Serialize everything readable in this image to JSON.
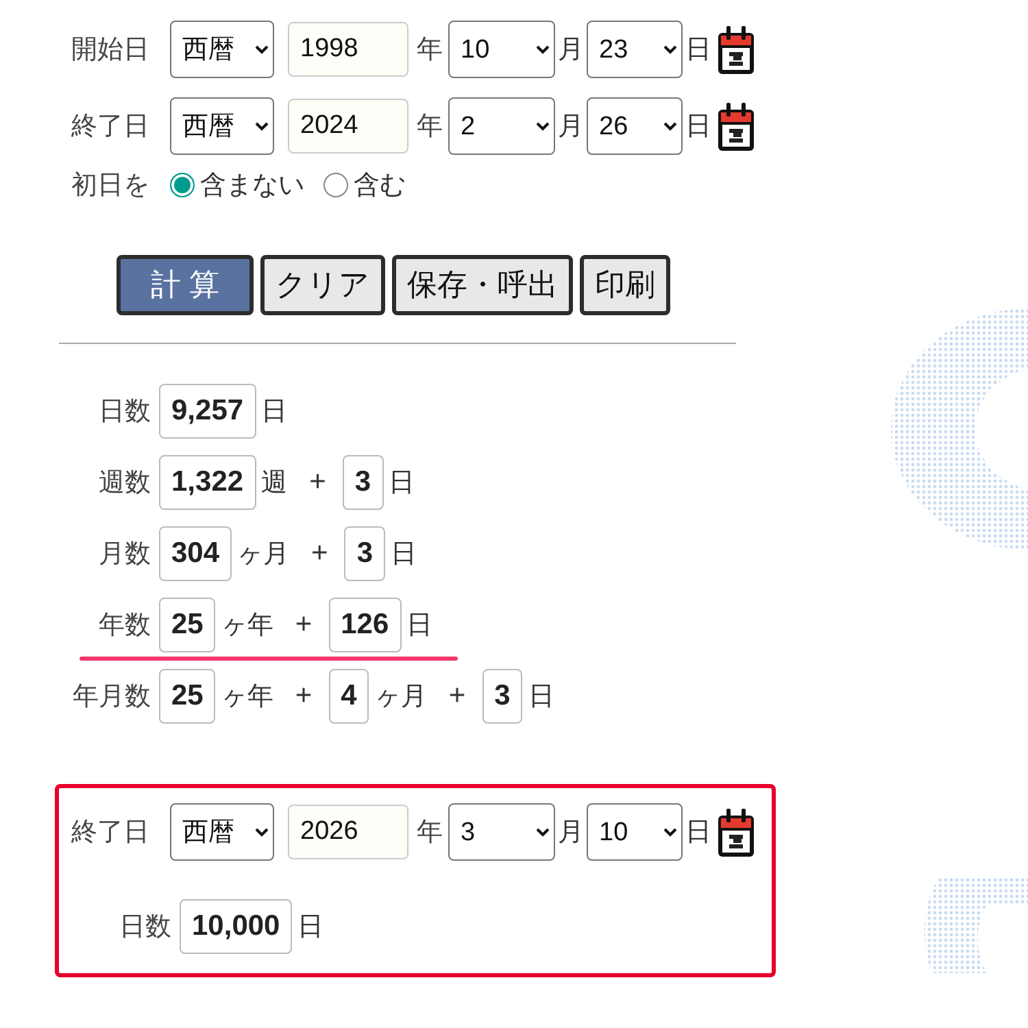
{
  "start_date": {
    "label": "開始日",
    "era": "西暦",
    "year": "1998",
    "year_unit": "年",
    "month": "10",
    "month_unit": "月",
    "day": "23",
    "day_unit": "日"
  },
  "end_date": {
    "label": "終了日",
    "era": "西暦",
    "year": "2024",
    "year_unit": "年",
    "month": "2",
    "month_unit": "月",
    "day": "26",
    "day_unit": "日"
  },
  "first_day": {
    "label": "初日を",
    "options": [
      {
        "label": "含まない",
        "selected": true
      },
      {
        "label": "含む",
        "selected": false
      }
    ]
  },
  "buttons": [
    {
      "label": "計 算",
      "kind": "primary"
    },
    {
      "label": "クリア",
      "kind": "plain"
    },
    {
      "label": "保存・呼出",
      "kind": "plain"
    },
    {
      "label": "印刷",
      "kind": "plain"
    }
  ],
  "results": [
    {
      "label": "日数",
      "highlighted": false,
      "parts": [
        {
          "kind": "value",
          "text": "9,257"
        },
        {
          "kind": "unit",
          "text": "日"
        }
      ]
    },
    {
      "label": "週数",
      "highlighted": false,
      "parts": [
        {
          "kind": "value",
          "text": "1,322"
        },
        {
          "kind": "unit",
          "text": "週"
        },
        {
          "kind": "op",
          "text": "+"
        },
        {
          "kind": "value",
          "text": "3"
        },
        {
          "kind": "unit",
          "text": "日"
        }
      ]
    },
    {
      "label": "月数",
      "highlighted": false,
      "parts": [
        {
          "kind": "value",
          "text": "304"
        },
        {
          "kind": "unit",
          "text": "ヶ月"
        },
        {
          "kind": "op",
          "text": "+"
        },
        {
          "kind": "value",
          "text": "3"
        },
        {
          "kind": "unit",
          "text": "日"
        }
      ]
    },
    {
      "label": "年数",
      "highlighted": true,
      "parts": [
        {
          "kind": "value",
          "text": "25"
        },
        {
          "kind": "unit",
          "text": "ヶ年"
        },
        {
          "kind": "op",
          "text": "+"
        },
        {
          "kind": "value",
          "text": "126"
        },
        {
          "kind": "unit",
          "text": "日"
        }
      ]
    },
    {
      "label": "年月数",
      "highlighted": false,
      "parts": [
        {
          "kind": "value",
          "text": "25"
        },
        {
          "kind": "unit",
          "text": "ヶ年"
        },
        {
          "kind": "op",
          "text": "+"
        },
        {
          "kind": "value",
          "text": "4"
        },
        {
          "kind": "unit",
          "text": "ヶ月"
        },
        {
          "kind": "op",
          "text": "+"
        },
        {
          "kind": "value",
          "text": "3"
        },
        {
          "kind": "unit",
          "text": "日"
        }
      ]
    }
  ],
  "target": {
    "highlighted": true,
    "end_date": {
      "label": "終了日",
      "era": "西暦",
      "year": "2026",
      "year_unit": "年",
      "month": "3",
      "month_unit": "月",
      "day": "10",
      "day_unit": "日"
    },
    "days": {
      "label": "日数",
      "parts": [
        {
          "kind": "value",
          "text": "10,000"
        },
        {
          "kind": "unit",
          "text": "日"
        }
      ]
    }
  }
}
